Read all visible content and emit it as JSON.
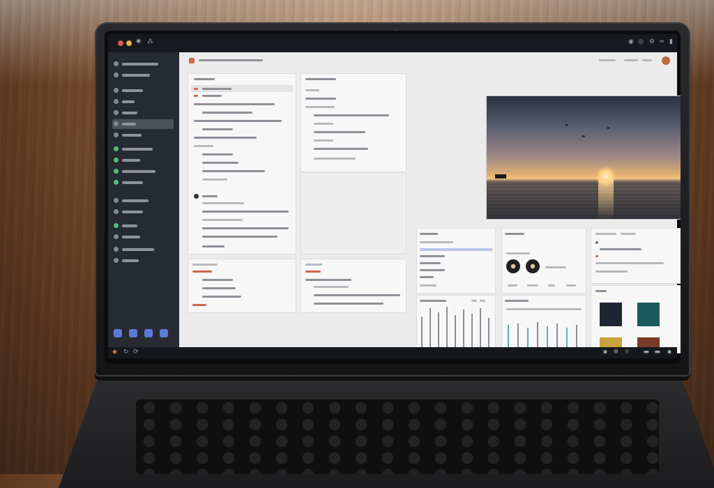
{
  "scene": {
    "description_labels": {}
  },
  "window": {
    "title": "",
    "topbar_icons": [
      "red-dot-icon",
      "yellow-dot-icon",
      "gear-icon",
      "menu-icon"
    ],
    "topbar_right_icons": [
      "record-icon",
      "circle-icon",
      "settings-icon",
      "wifi-icon",
      "battery-icon"
    ]
  },
  "sidebar": {
    "items": [
      {
        "icon": "home-icon",
        "label": ""
      },
      {
        "icon": "search-icon",
        "label": ""
      },
      {
        "icon": "clock-icon",
        "label": ""
      },
      {
        "icon": "folder-icon",
        "label": ""
      },
      {
        "icon": "star-icon",
        "label": ""
      },
      {
        "icon": "music-icon",
        "label": ""
      },
      {
        "icon": "list-icon",
        "label": ""
      },
      {
        "icon": "tag-icon",
        "label": ""
      },
      {
        "icon": "user-icon",
        "label": ""
      },
      {
        "icon": "cloud-icon",
        "label": ""
      },
      {
        "icon": "settings-icon",
        "label": ""
      }
    ],
    "dock_icons": [
      "chat-icon",
      "mail-icon",
      "files-icon",
      "calendar-icon"
    ]
  },
  "main": {
    "header": {
      "title": ""
    },
    "photo_panel": {
      "label": "sunset-photo"
    }
  },
  "colors": {
    "accent": "#5b7ad8",
    "highlight": "#d0644c",
    "status_green": "#4fbf7a"
  }
}
